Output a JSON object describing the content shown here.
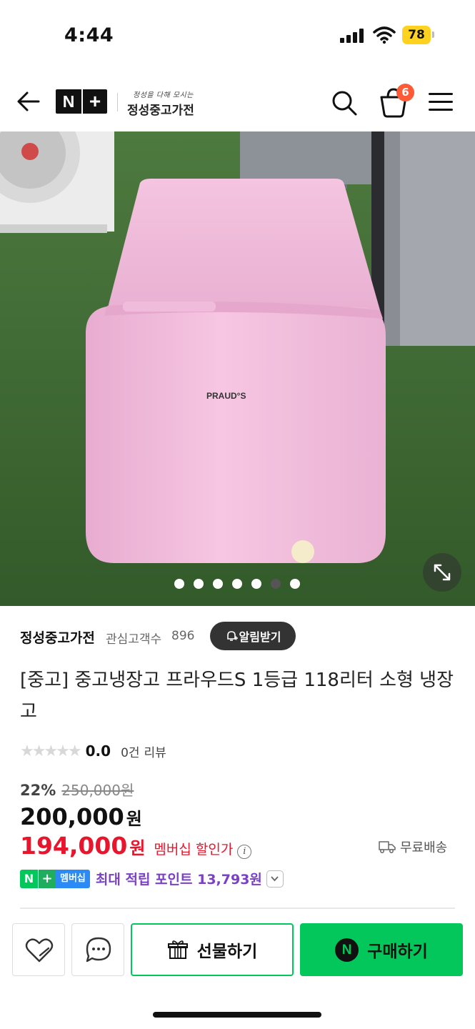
{
  "status_bar": {
    "time": "4:44",
    "battery": "78",
    "icons": [
      "signal-icon",
      "wifi-icon",
      "battery-icon"
    ]
  },
  "header": {
    "back_icon": "arrow-left-icon",
    "logo_n": "N",
    "logo_plus": "+",
    "store_slogan": "정성을 다해 모시는",
    "store_logo_name": "정성중고가전",
    "cart_count": "6",
    "icons": [
      "search-icon",
      "cart-icon",
      "menu-icon"
    ]
  },
  "gallery": {
    "image_label": "PRAUD°S",
    "dot_count": 7,
    "active_dot": 5,
    "expand_icon": "expand-icon"
  },
  "store": {
    "name": "정성중고가전",
    "follower_label": "관심고객수",
    "follower_count": "896",
    "alert_button": "알림받기"
  },
  "product": {
    "title": "[중고] 중고냉장고 프라우드S 1등급 118리터 소형 냉장고",
    "rating": "0.0",
    "review_count": "0건",
    "review_label": "리뷰",
    "discount_rate": "22%",
    "original_price": "250,000원",
    "sale_price": "200,000",
    "sale_unit": "원",
    "member_price": "194,000",
    "member_unit": "원",
    "member_label": "멤버십 할인가",
    "shipping": "무료배송",
    "points_badge_n": "N",
    "points_badge_plus": "+",
    "points_badge_member": "멤버십",
    "points_text": "최대 적립 포인트 13,793원"
  },
  "bottom_bar": {
    "gift_label": "선물하기",
    "buy_label": "구매하기",
    "buy_icon_letter": "N"
  },
  "colors": {
    "naver_green": "#03c75a",
    "price_red": "#e8162d",
    "points_purple": "#7a40c8",
    "badge_orange": "#ff5a36",
    "fridge_pink": "#f2bcdc"
  }
}
